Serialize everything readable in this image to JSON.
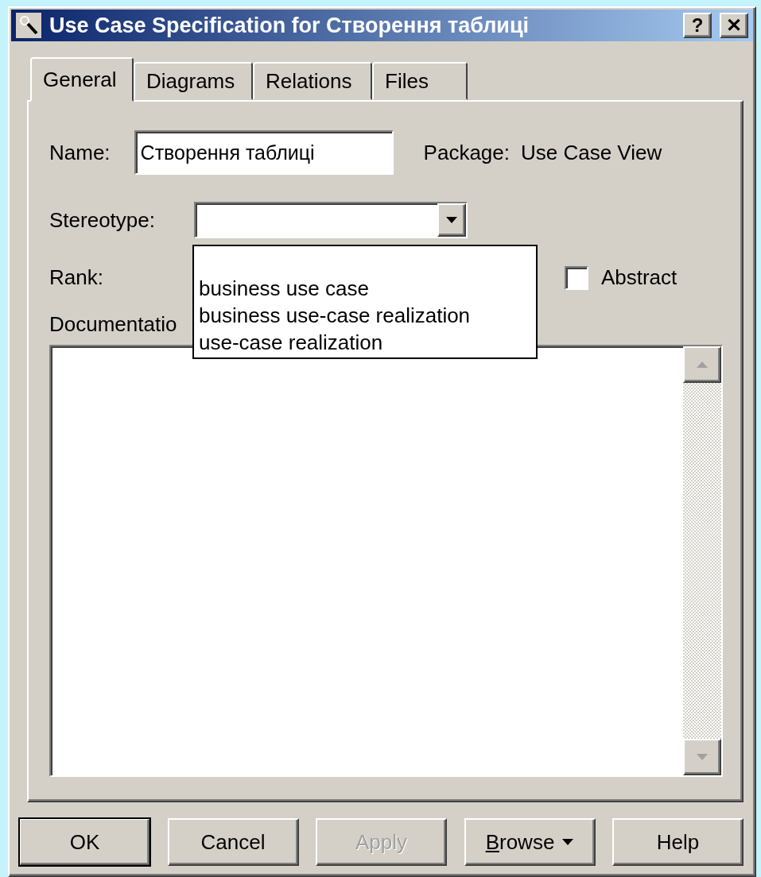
{
  "window": {
    "title": "Use Case Specification for Створення таблиці",
    "help_button": "?",
    "close_button": "✕"
  },
  "tabs": [
    {
      "label": "General",
      "selected": true
    },
    {
      "label": "Diagrams",
      "selected": false
    },
    {
      "label": "Relations",
      "selected": false
    },
    {
      "label": "Files",
      "selected": false
    }
  ],
  "name": {
    "label": "Name:",
    "value": "Створення таблиці"
  },
  "package": {
    "label": "Package:",
    "value": "Use Case View"
  },
  "stereotype": {
    "label": "Stereotype:",
    "expanded": true,
    "options": [
      "business use case",
      "business use-case realization",
      "use-case realization"
    ]
  },
  "rank": {
    "label": "Rank:"
  },
  "abstract": {
    "label": "Abstract",
    "checked": false
  },
  "documentation": {
    "label": "Documentatio"
  },
  "buttons": [
    {
      "label": "OK",
      "default": true,
      "disabled": false
    },
    {
      "label": "Cancel",
      "default": false,
      "disabled": false
    },
    {
      "label": "Apply",
      "default": false,
      "disabled": true
    },
    {
      "label": "Browse",
      "kind": "menu",
      "default": false,
      "disabled": false
    },
    {
      "label": "Help",
      "default": false,
      "disabled": false
    }
  ]
}
